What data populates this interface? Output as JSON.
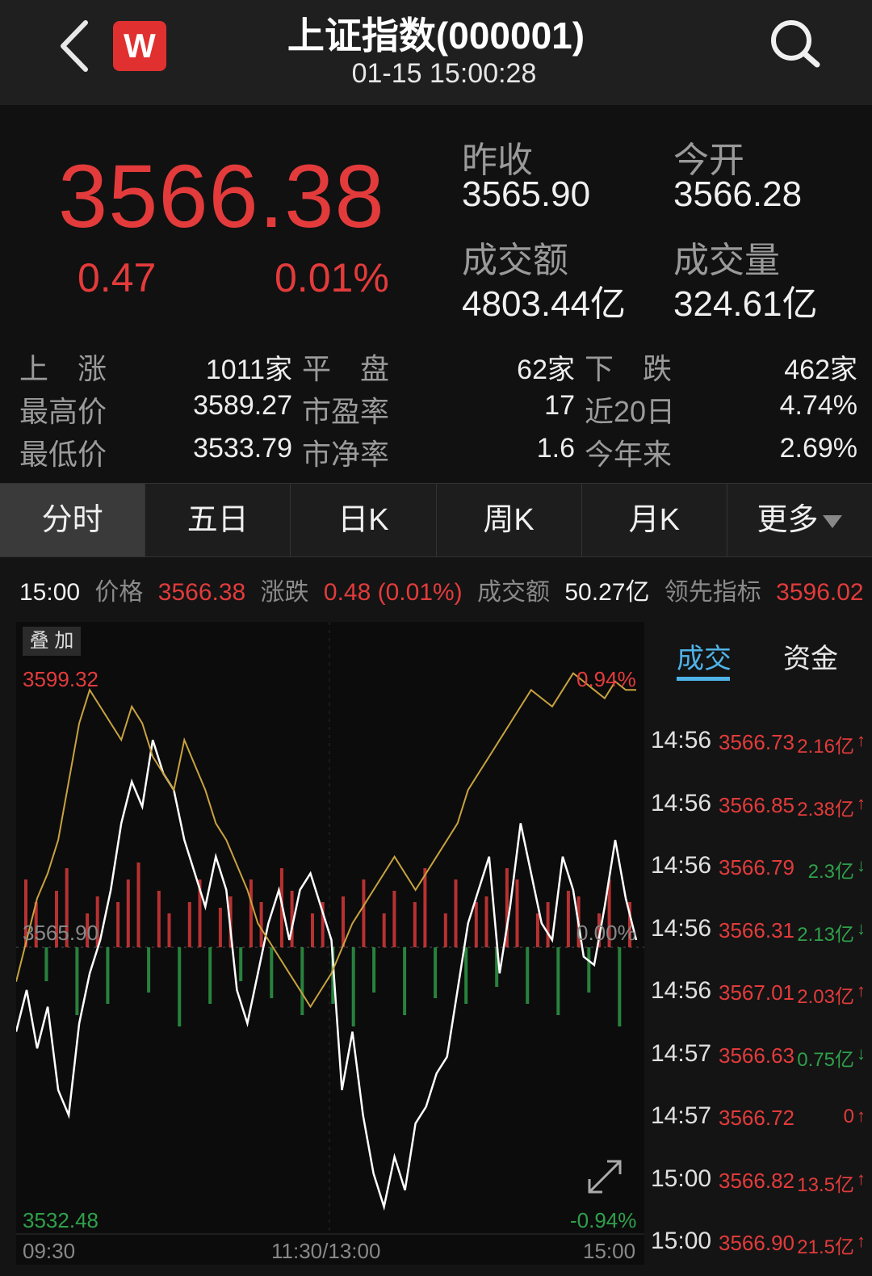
{
  "header": {
    "title": "上证指数(000001)",
    "datetime": "01-15 15:00:28",
    "logo_text": "W"
  },
  "quote": {
    "price": "3566.38",
    "change": "0.47",
    "change_pct": "0.01%",
    "prev_close_label": "昨收",
    "prev_close": "3565.90",
    "open_label": "今开",
    "open": "3566.28",
    "amount_label": "成交额",
    "amount": "4803.44亿",
    "volume_label": "成交量",
    "volume": "324.61亿"
  },
  "stats": {
    "up_label": "上　涨",
    "up": "1011家",
    "flat_label": "平　盘",
    "flat": "62家",
    "down_label": "下　跌",
    "down": "462家",
    "high_label": "最高价",
    "high": "3589.27",
    "pe_label": "市盈率",
    "pe": "17",
    "d20_label": "近20日",
    "d20": "4.74%",
    "low_label": "最低价",
    "low": "3533.79",
    "pb_label": "市净率",
    "pb": "1.6",
    "ytd_label": "今年来",
    "ytd": "2.69%"
  },
  "tabs": [
    "分时",
    "五日",
    "日K",
    "周K",
    "月K",
    "更多"
  ],
  "infobar": {
    "time": "15:00",
    "price_label": "价格",
    "price": "3566.38",
    "chg_label": "涨跌",
    "chg": "0.48 (0.01%)",
    "amt_label": "成交额",
    "amt": "50.27亿",
    "lead_label": "领先指标",
    "lead": "3596.02"
  },
  "chart_overlay_label": "叠 加",
  "chart_data": {
    "type": "line",
    "y_top": "3599.32",
    "y_mid": "3565.90",
    "y_bottom": "3532.48",
    "pct_top": "0.94%",
    "pct_mid": "0.00%",
    "pct_bottom": "-0.94%",
    "x_start": "09:30",
    "x_mid": "11:30/13:00",
    "x_end": "15:00",
    "ylim": [
      3532.48,
      3599.32
    ],
    "prev_close": 3565.9,
    "series": [
      {
        "values": [
          3555,
          3560,
          3553,
          3558,
          3548,
          3545,
          3556,
          3562,
          3566,
          3572,
          3580,
          3585,
          3582,
          3590,
          3586,
          3584,
          3578,
          3574,
          3570,
          3576,
          3572,
          3560,
          3556,
          3562,
          3568,
          3572,
          3566,
          3572,
          3574,
          3570,
          3566,
          3548,
          3555,
          3545,
          3538,
          3534,
          3540,
          3536,
          3544,
          3546,
          3550,
          3552,
          3560,
          3568,
          3572,
          3576,
          3562,
          3570,
          3580,
          3574,
          3568,
          3566,
          3576,
          3572,
          3564,
          3563,
          3570,
          3578,
          3571,
          3566
        ],
        "color": "#ffffff"
      },
      {
        "values": [
          3561,
          3566,
          3571,
          3574,
          3578,
          3585,
          3592,
          3596,
          3594,
          3592,
          3590,
          3594,
          3592,
          3588,
          3586,
          3584,
          3590,
          3587,
          3584,
          3580,
          3578,
          3575,
          3572,
          3568,
          3566,
          3564,
          3562,
          3560,
          3558,
          3560,
          3562,
          3565,
          3568,
          3570,
          3572,
          3574,
          3576,
          3574,
          3572,
          3574,
          3576,
          3578,
          3580,
          3584,
          3586,
          3588,
          3590,
          3592,
          3594,
          3596,
          3595,
          3594,
          3596,
          3598,
          3597,
          3596,
          3595,
          3597,
          3596,
          3596
        ],
        "color": "#c9a340"
      }
    ],
    "volume": [
      12,
      8,
      -6,
      10,
      14,
      -12,
      6,
      9,
      -10,
      8,
      12,
      15,
      -8,
      10,
      6,
      -14,
      8,
      12,
      -10,
      7,
      9,
      -6,
      12,
      8,
      -9,
      14,
      10,
      -12,
      6,
      8,
      -10,
      9,
      -14,
      12,
      -8,
      6,
      10,
      -12,
      8,
      14,
      -9,
      6,
      12,
      -10,
      8,
      9,
      -7,
      14,
      12,
      -10,
      6,
      8,
      -12,
      10,
      9,
      -8,
      6,
      12,
      -14,
      8
    ]
  },
  "side": {
    "tab_deal": "成交",
    "tab_fund": "资金",
    "trades": [
      {
        "time": "14:56",
        "price": "3566.73",
        "vol": "2.16亿",
        "dir": "↑"
      },
      {
        "time": "14:56",
        "price": "3566.85",
        "vol": "2.38亿",
        "dir": "↑"
      },
      {
        "time": "14:56",
        "price": "3566.79",
        "vol": "2.3亿",
        "dir": "↓"
      },
      {
        "time": "14:56",
        "price": "3566.31",
        "vol": "2.13亿",
        "dir": "↓"
      },
      {
        "time": "14:56",
        "price": "3567.01",
        "vol": "2.03亿",
        "dir": "↑"
      },
      {
        "time": "14:57",
        "price": "3566.63",
        "vol": "0.75亿",
        "dir": "↓"
      },
      {
        "time": "14:57",
        "price": "3566.72",
        "vol": "0",
        "dir": "↑"
      },
      {
        "time": "15:00",
        "price": "3566.82",
        "vol": "13.5亿",
        "dir": "↑"
      },
      {
        "time": "15:00",
        "price": "3566.90",
        "vol": "21.5亿",
        "dir": "↑"
      }
    ]
  },
  "colors": {
    "up": "#e33b3b",
    "down": "#2fa04a",
    "accent": "#4fb3e8"
  }
}
